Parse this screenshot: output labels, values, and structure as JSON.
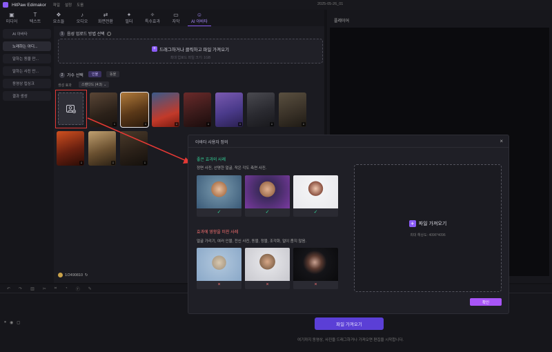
{
  "app": {
    "name": "HitPaw Edimakor",
    "menus": [
      "파일",
      "설정",
      "도움"
    ],
    "project_title": "2025-05-26_01"
  },
  "toolbar": {
    "tools": [
      {
        "label": "미디어",
        "icon": "media-icon"
      },
      {
        "label": "텍스트",
        "icon": "text-icon"
      },
      {
        "label": "요소들",
        "icon": "elements-icon"
      },
      {
        "label": "오디오",
        "icon": "audio-icon"
      },
      {
        "label": "화면전환",
        "icon": "transition-icon"
      },
      {
        "label": "필터",
        "icon": "filter-icon"
      },
      {
        "label": "특수효과",
        "icon": "effects-icon"
      },
      {
        "label": "자막",
        "icon": "subtitle-icon"
      },
      {
        "label": "AI 아바타",
        "icon": "ai-avatar-icon"
      }
    ],
    "active_index": 8
  },
  "leftnav": {
    "items": [
      "AI 아바타",
      "노래하는 아디...",
      "말하는 동물 만...",
      "말하는 사진 만...",
      "동영상 립싱크",
      "결과 생성"
    ],
    "active_index": 1
  },
  "content": {
    "step1_title": "음성 업로드 방법 선택",
    "upload_text": "드래그하거나 클릭하고 파일 가져오기",
    "upload_sub": "최대 업로드 파일 크기: 1GB",
    "step2_title": "가수 선택",
    "tabs": [
      "인물",
      "동물"
    ],
    "effect_label": "생성 효과",
    "ratio": "스탠다드 (4:3)",
    "credits": "1/2490810"
  },
  "player": {
    "title": "플레이어"
  },
  "timeline": {
    "import_label": "파일 가져오기",
    "hint": "여기까지 동영상, 사진을 드래그하거나 가져오면 편집을 시작합니다."
  },
  "modal": {
    "title": "아바타 사용자 정의",
    "good_title": "좋은 효과의 사례",
    "good_desc": "정면 사진, 선명한 얼굴, 작은 각도 측면 사진.",
    "bad_title": "효과에 영향을 미친 사례",
    "bad_desc": "얼굴 가리기, 여러 인물, 전신 사진, 동물, 정물, 조각화, 얼이 좀지 않음.",
    "drop_label": "파일 가져오기",
    "drop_sub": "최대 해상도: 4096*4096",
    "confirm": "확인",
    "ok_mark": "✓",
    "no_mark": "×"
  },
  "colors": {
    "accent": "#8b5cf6",
    "good": "#34d399",
    "bad": "#f87171",
    "highlight": "#e53935"
  }
}
